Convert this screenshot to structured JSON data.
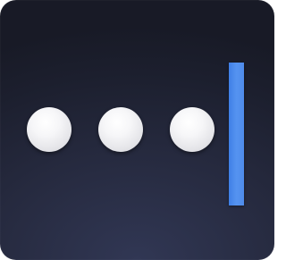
{
  "icon": {
    "semantic": "password-manager-app-icon",
    "masked_dots": 3,
    "colors": {
      "background_dark": "#181a26",
      "background_light": "#313754",
      "dot": "#f2f2f4",
      "cursor": "#4f8ceb"
    }
  }
}
